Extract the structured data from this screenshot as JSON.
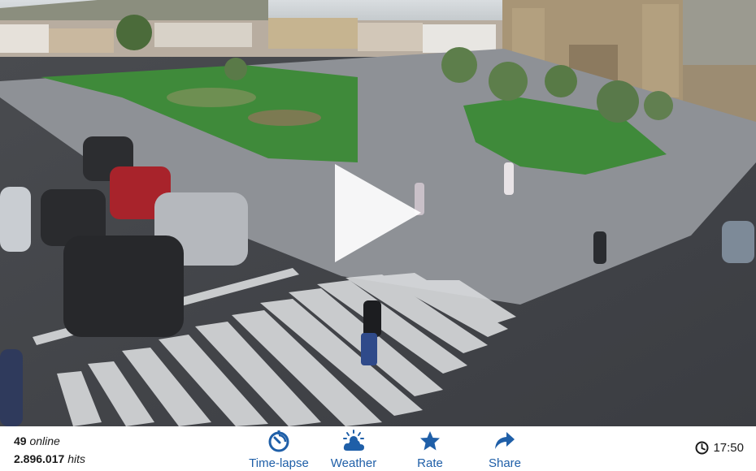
{
  "player": {
    "play_icon": "play-icon",
    "scene_description_icon": "webcam-view"
  },
  "stats": {
    "online_count": "49",
    "online_label": "online",
    "hits_count": "2.896.017",
    "hits_label": "hits"
  },
  "actions": [
    {
      "label": "Time-lapse",
      "icon": "timelapse-icon"
    },
    {
      "label": "Weather",
      "icon": "weather-icon"
    },
    {
      "label": "Rate",
      "icon": "star-icon"
    },
    {
      "label": "Share",
      "icon": "share-icon"
    }
  ],
  "clock": {
    "time": "17:50",
    "icon": "clock-icon"
  },
  "colors": {
    "accent": "#1f5fa8",
    "text": "#1a1a1a"
  }
}
